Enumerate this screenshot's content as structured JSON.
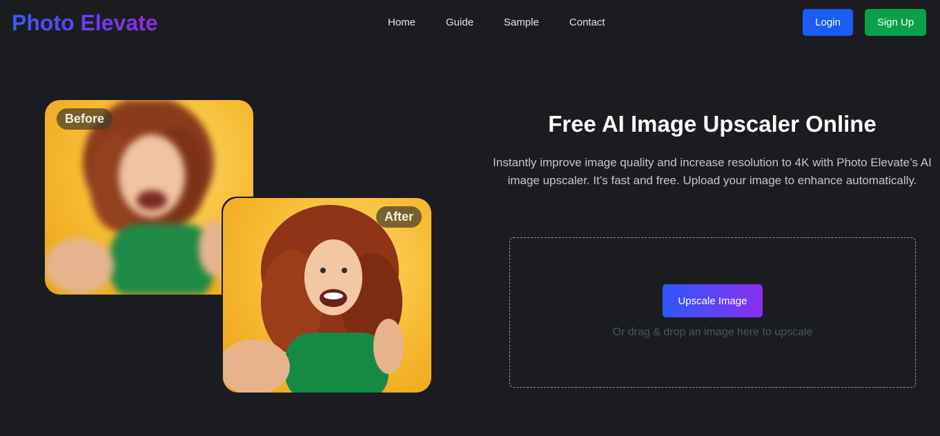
{
  "header": {
    "logo": "Photo Elevate",
    "nav": [
      "Home",
      "Guide",
      "Sample",
      "Contact"
    ],
    "login_label": "Login",
    "signup_label": "Sign Up"
  },
  "illustration": {
    "before_label": "Before",
    "after_label": "After"
  },
  "hero": {
    "title": "Free AI Image Upscaler Online",
    "description": "Instantly improve image quality and increase resolution to 4K with Photo Elevate’s AI image upscaler. It’s fast and free. Upload your image to enhance automatically."
  },
  "upload": {
    "button_label": "Upscale Image",
    "hint": "Or drag & drop an image here to upscale"
  },
  "colors": {
    "background": "#1b1c1f",
    "login": "#1a5cf5",
    "signup": "#0aa14a",
    "accent_start": "#2f58f7",
    "accent_end": "#8a2ff0"
  }
}
